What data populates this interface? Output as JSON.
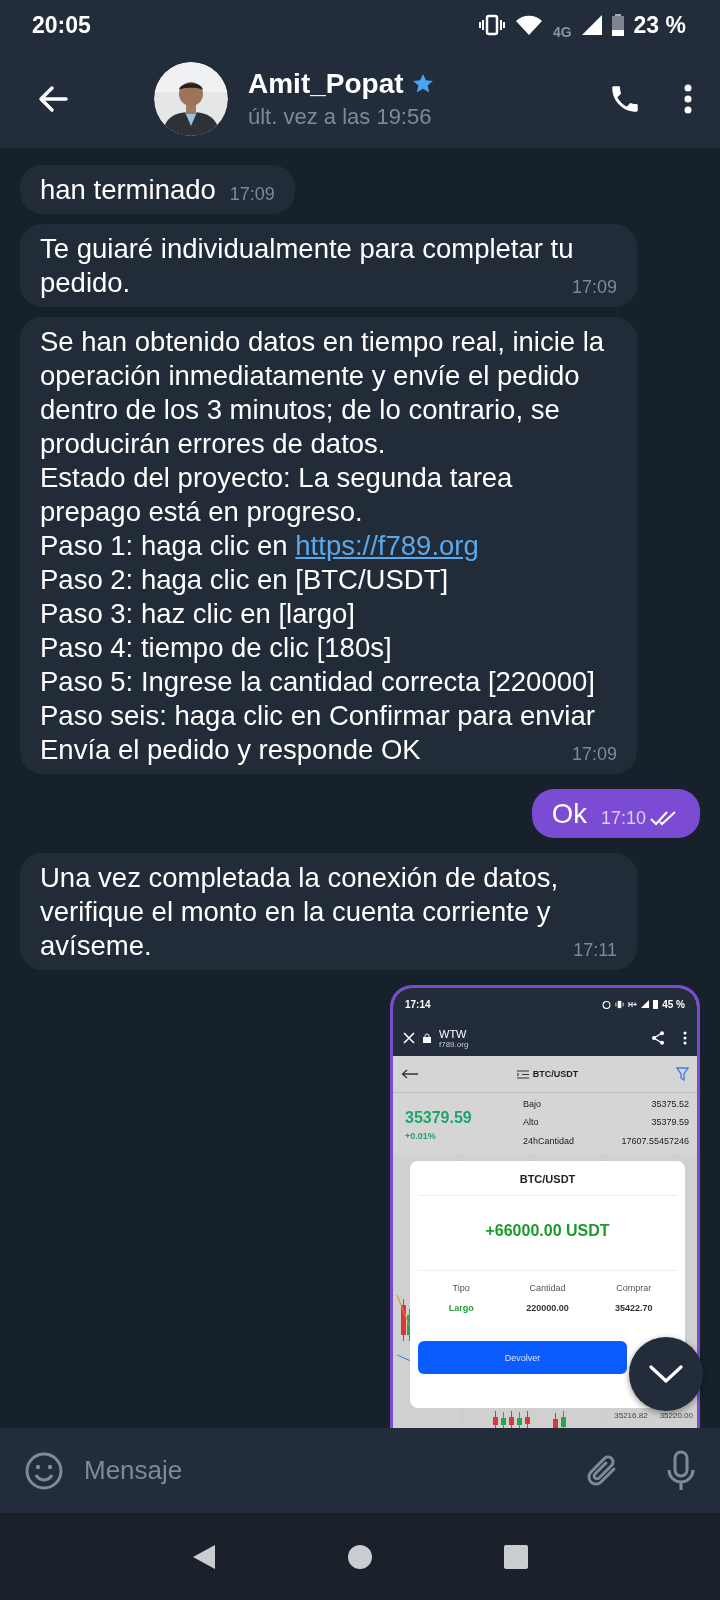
{
  "status_bar": {
    "time": "20:05",
    "network": "4G",
    "battery": "23 %"
  },
  "header": {
    "name": "Amit_Popat",
    "last_seen": "últ. vez a las 19:56"
  },
  "messages": [
    {
      "kind": "text",
      "outgoing": false,
      "paragraphs": [
        {
          "text": "han terminado"
        }
      ],
      "time": "17:09"
    },
    {
      "kind": "text",
      "outgoing": false,
      "paragraphs": [
        {
          "text": "Te guiaré individualmente para completar tu pedido."
        }
      ],
      "time": "17:09"
    },
    {
      "kind": "text",
      "outgoing": false,
      "paragraphs": [
        {
          "text": "Se han obtenido datos en tiempo real, inicie la operación inmediatamente y envíe el pedido dentro de los 3 minutos; de lo contrario, se producirán errores de datos."
        },
        {
          "text": "Estado del proyecto: La segunda tarea prepago está en progreso."
        },
        {
          "text": "Paso 1: haga clic en",
          "link": "https://f789.org"
        },
        {
          "text": "Paso 2: haga clic en [BTC/USDT]"
        },
        {
          "text": "Paso 3: haz clic en [largo]"
        },
        {
          "text": "Paso 4: tiempo de clic [180s]"
        },
        {
          "text": "Paso 5: Ingrese la cantidad correcta [220000]"
        },
        {
          "text": "Paso seis: haga clic en Confirmar para enviar"
        },
        {
          "text": "Envía el pedido y responde OK"
        }
      ],
      "time": "17:09"
    },
    {
      "kind": "text",
      "outgoing": true,
      "paragraphs": [
        {
          "text": "Ok"
        }
      ],
      "time": "17:10",
      "read": true
    },
    {
      "kind": "text",
      "outgoing": false,
      "paragraphs": [
        {
          "text": "Una vez completada la conexión de datos, verifique el monto en la cuenta corriente y avíseme."
        }
      ],
      "time": "17:11"
    },
    {
      "outgoing": true,
      "screen": {
        "time": "17:14",
        "network": "H+",
        "battery": "45 %",
        "page_title": "WTW",
        "page_url": "f789.org",
        "pair": "BTC/USDT",
        "price": "35379.59",
        "change": "+0.01%",
        "stats": [
          {
            "label": "Bajo",
            "value": "35375.52"
          },
          {
            "label": "Alto",
            "value": "35379.59"
          },
          {
            "label": "24hCantidad",
            "value": "17607.55457246"
          }
        ],
        "dialog": {
          "title": "BTC/USDT",
          "amount": "+66000.00 USDT",
          "columns": [
            {
              "label": "Tipo",
              "value": "Largo",
              "kind": "positive"
            },
            {
              "label": "Cantidad",
              "value": "220000.00",
              "kind": "plain"
            },
            {
              "label": "Comprar",
              "value": "35422.70",
              "kind": "plain"
            }
          ],
          "button": "Devolver"
        },
        "chart_labels": [
          "35216.82",
          "35220.00"
        ]
      }
    }
  ],
  "composer": {
    "placeholder": "Mensaje"
  }
}
